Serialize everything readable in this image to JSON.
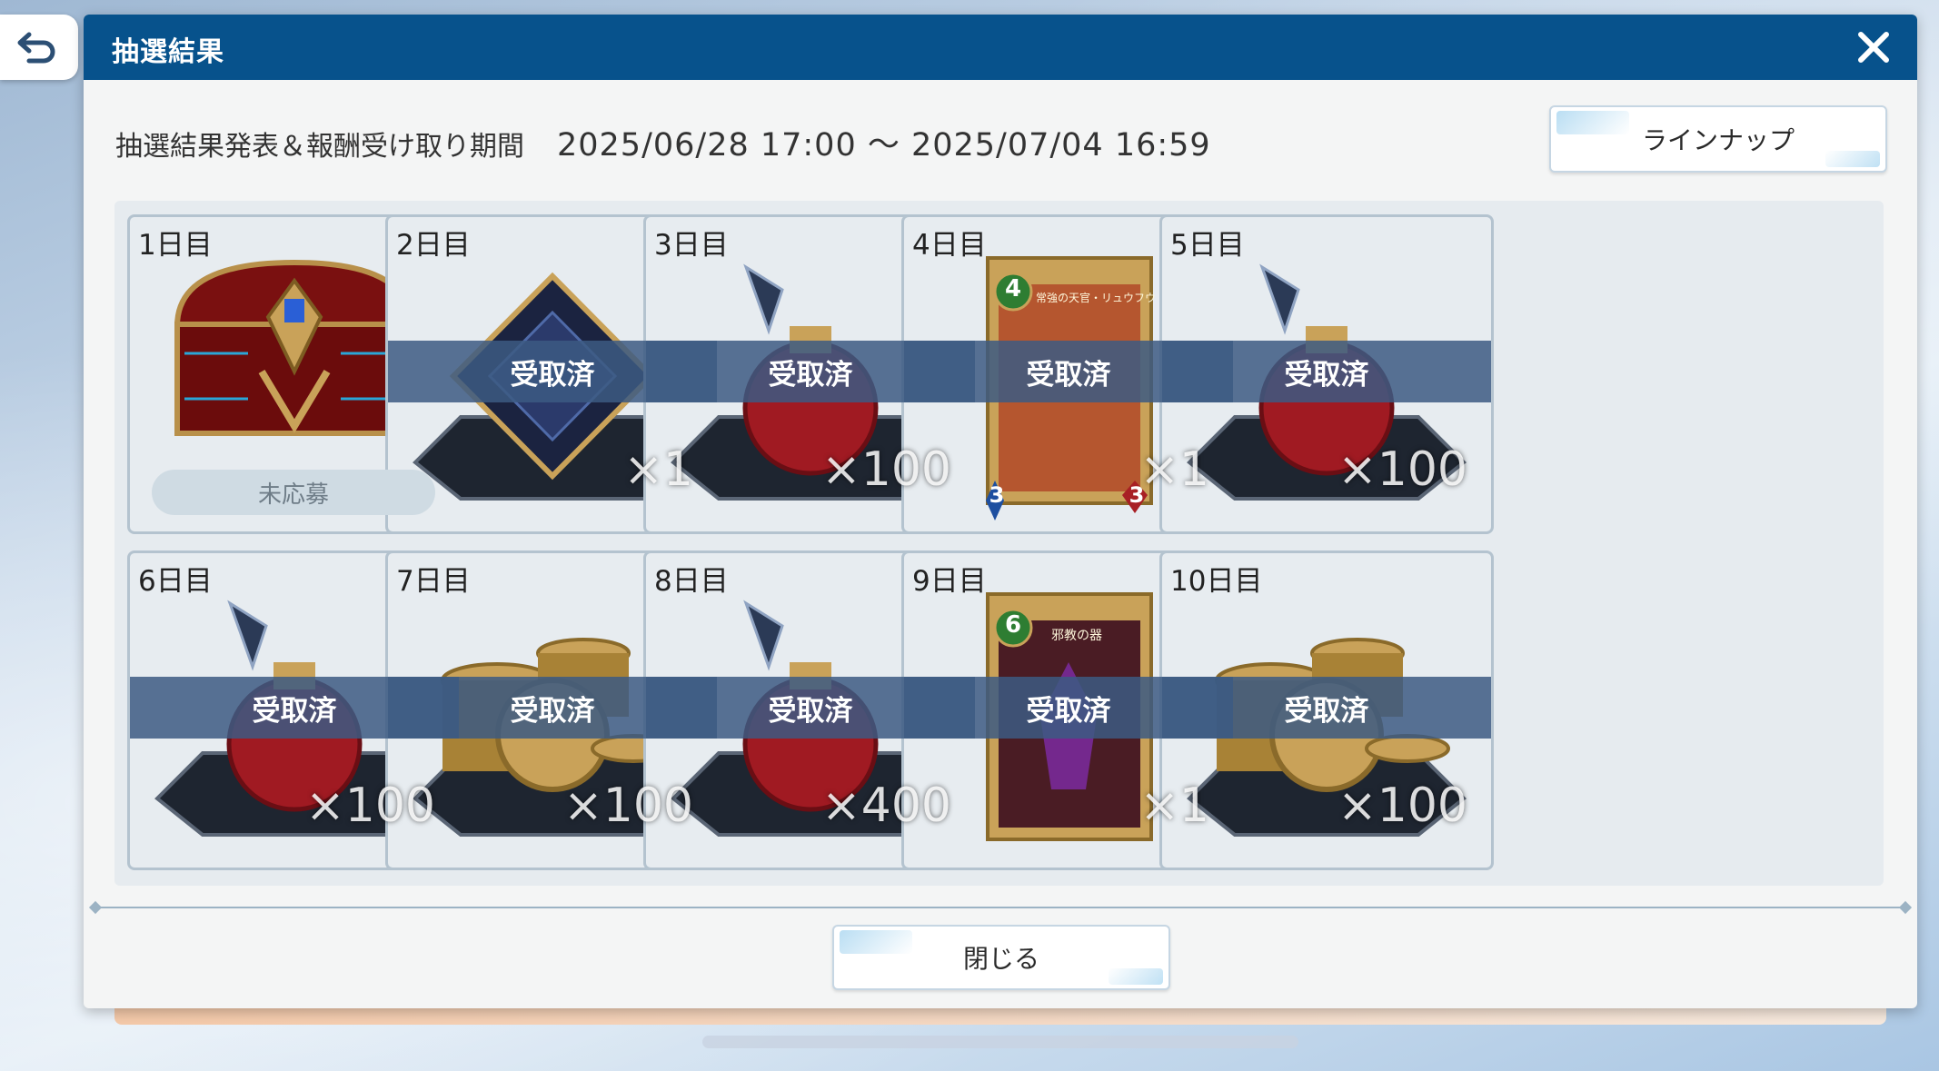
{
  "dialog": {
    "title": "抽選結果"
  },
  "period": {
    "label": "抽選結果発表＆報酬受け取り期間",
    "range": "2025/06/28 17:00 ～ 2025/07/04 16:59"
  },
  "buttons": {
    "lineup": "ラインナップ",
    "close": "閉じる"
  },
  "days": [
    {
      "label": "1日目",
      "status": "未応募",
      "qty": "",
      "reward_icon": "treasure-chest-icon"
    },
    {
      "label": "2日目",
      "status": "受取済",
      "qty": "×1",
      "reward_icon": "card-pack-icon"
    },
    {
      "label": "3日目",
      "status": "受取済",
      "qty": "×100",
      "reward_icon": "potion-icon"
    },
    {
      "label": "4日目",
      "status": "受取済",
      "qty": "×1",
      "reward_icon": "card-icon",
      "card": {
        "cost": "4",
        "name": "常強の天官・リュウフウ",
        "atk": "3",
        "hp": "3"
      }
    },
    {
      "label": "5日目",
      "status": "受取済",
      "qty": "×100",
      "reward_icon": "potion-icon"
    },
    {
      "label": "6日目",
      "status": "受取済",
      "qty": "×100",
      "reward_icon": "potion-icon"
    },
    {
      "label": "7日目",
      "status": "受取済",
      "qty": "×100",
      "reward_icon": "coins-icon"
    },
    {
      "label": "8日目",
      "status": "受取済",
      "qty": "×400",
      "reward_icon": "potion-icon"
    },
    {
      "label": "9日目",
      "status": "受取済",
      "qty": "×1",
      "reward_icon": "card-icon",
      "card": {
        "cost": "6",
        "name": "邪教の器"
      }
    },
    {
      "label": "10日目",
      "status": "受取済",
      "qty": "×100",
      "reward_icon": "coins-icon"
    }
  ],
  "colors": {
    "header": "#07528c",
    "band": "#3c5a82",
    "card_border": "#b4c3cf"
  }
}
